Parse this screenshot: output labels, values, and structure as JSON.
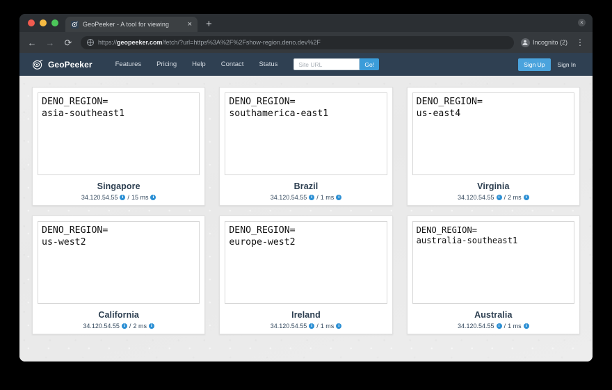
{
  "window": {
    "close_label": "×"
  },
  "tab": {
    "title": "GeoPeeker - A tool for viewing",
    "close_label": "×",
    "new_tab_label": "+",
    "favicon_name": "geopeeker-favicon"
  },
  "toolbar": {
    "back_label": "←",
    "forward_label": "→",
    "reload_label": "⟳",
    "url_domain": "geopeeker.com",
    "url_prefix": "https://",
    "url_suffix": "/fetch/?url=https%3A%2F%2Fshow-region.deno.dev%2F",
    "url_full": "https://geopeeker.com/fetch/?url=https%3A%2F%2Fshow-region.deno.dev%2F",
    "incognito_label": "Incognito (2)",
    "menu_label": "⋮"
  },
  "site_nav": {
    "brand": "GeoPeeker",
    "brand_icon": "globe-eye-logo-icon",
    "links": [
      {
        "label": "Features"
      },
      {
        "label": "Pricing"
      },
      {
        "label": "Help"
      },
      {
        "label": "Contact"
      },
      {
        "label": "Status"
      }
    ],
    "search": {
      "placeholder": "Site URL",
      "value": "",
      "submit_label": "Go!"
    },
    "signup_label": "Sign Up",
    "signin_label": "Sign In",
    "bg_color": "#2f4052",
    "accent_color": "#4aa3dd"
  },
  "results": {
    "cards": [
      {
        "screenshot_line1": "DENO_REGION=",
        "screenshot_line2": "asia-southeast1",
        "city": "Singapore",
        "ip": "34.120.54.55",
        "latency": "15 ms",
        "separator": "/",
        "tight": false
      },
      {
        "screenshot_line1": "DENO_REGION=",
        "screenshot_line2": "southamerica-east1",
        "city": "Brazil",
        "ip": "34.120.54.55",
        "latency": "1 ms",
        "separator": "/",
        "tight": false
      },
      {
        "screenshot_line1": "DENO_REGION=",
        "screenshot_line2": "us-east4",
        "city": "Virginia",
        "ip": "34.120.54.55",
        "latency": "2 ms",
        "separator": "/",
        "tight": false
      },
      {
        "screenshot_line1": "DENO_REGION=",
        "screenshot_line2": "us-west2",
        "city": "California",
        "ip": "34.120.54.55",
        "latency": "2 ms",
        "separator": "/",
        "tight": false
      },
      {
        "screenshot_line1": "DENO_REGION=",
        "screenshot_line2": "europe-west2",
        "city": "Ireland",
        "ip": "34.120.54.55",
        "latency": "1 ms",
        "separator": "/",
        "tight": false
      },
      {
        "screenshot_line1": "DENO_REGION=",
        "screenshot_line2": "australia-southeast1",
        "city": "Australia",
        "ip": "34.120.54.55",
        "latency": "1 ms",
        "separator": "/",
        "tight": true
      }
    ],
    "info_icon_label": "i"
  }
}
